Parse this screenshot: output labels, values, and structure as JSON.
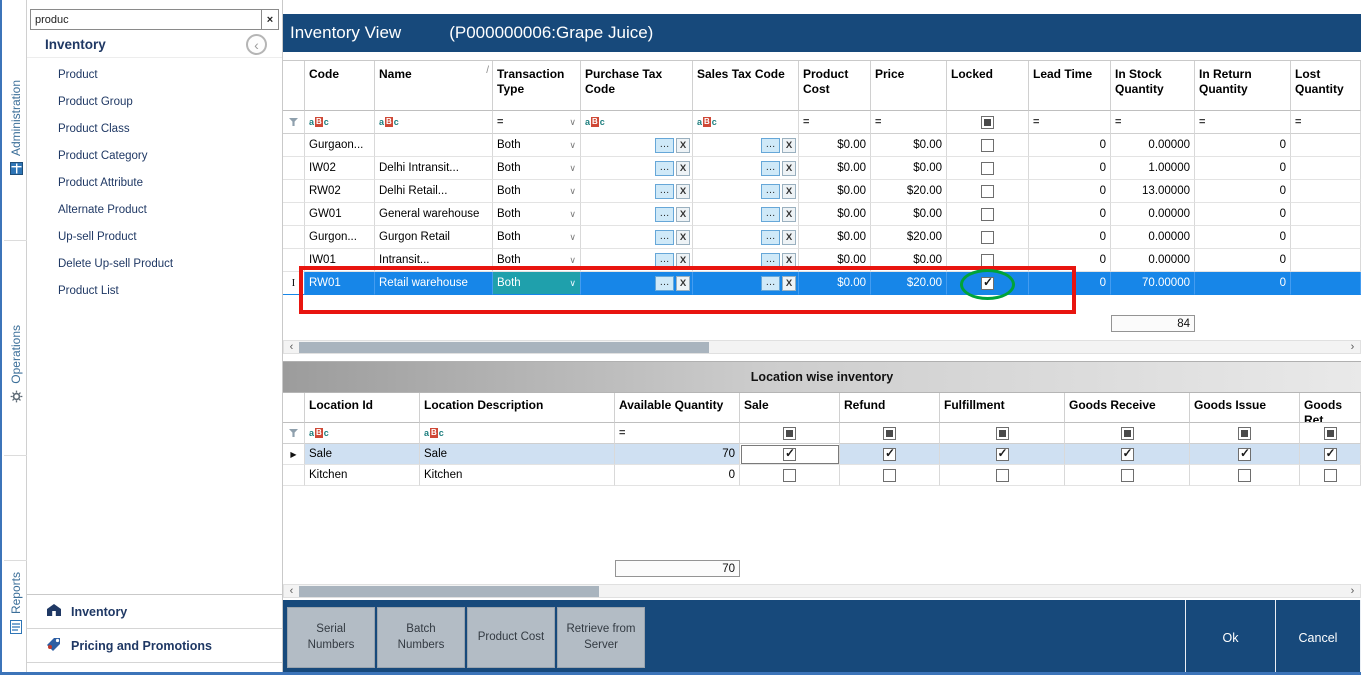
{
  "colors": {
    "title_bar": "#17497B",
    "selected_row": "#1786E8",
    "sidebar_text": "#1F3864",
    "annotation_red": "#E8150F",
    "annotation_green": "#00A33A"
  },
  "icons": {
    "search_clear": "×",
    "back": "‹",
    "dropdown": "∨",
    "ellipsis": "…",
    "clear_x": "X",
    "abc_a": "a",
    "abc_b": "B",
    "abc_c": "c",
    "equals": "=",
    "sort": "/",
    "row_edit": "I",
    "row_current": "▶",
    "scroll_left": "‹",
    "scroll_right": "›"
  },
  "vertical_nav": {
    "items": [
      {
        "label": "Administration"
      },
      {
        "label": "Operations"
      },
      {
        "label": "Reports"
      }
    ]
  },
  "sidebar": {
    "search_value": "produc",
    "title": "Inventory",
    "items": [
      "Product",
      "Product Group",
      "Product Class",
      "Product Category",
      "Product Attribute",
      "Alternate Product",
      "Up-sell Product",
      "Delete Up-sell Product",
      "Product List"
    ],
    "footer_items": [
      {
        "label": "Inventory"
      },
      {
        "label": "Pricing and Promotions"
      }
    ]
  },
  "title_bar": {
    "view_title": "Inventory View",
    "record_title": "(P000000006:Grape Juice)"
  },
  "inventory_grid": {
    "columns": {
      "code": "Code",
      "name": "Name",
      "transaction_type": "Transaction Type",
      "purchase_tax": "Purchase Tax Code",
      "sales_tax": "Sales Tax Code",
      "product_cost": "Product Cost",
      "price": "Price",
      "locked": "Locked",
      "lead_time": "Lead Time",
      "in_stock": "In Stock Quantity",
      "in_return": "In Return Quantity",
      "lost": "Lost Quantity"
    },
    "rows": [
      {
        "code": "Gurgaon...",
        "name": "",
        "transaction_type": "Both",
        "product_cost": "$0.00",
        "price": "$0.00",
        "locked": false,
        "lead_time": "0",
        "in_stock": "0.00000",
        "in_return": "0",
        "lost": "",
        "selected": false
      },
      {
        "code": "IW02",
        "name": "Delhi Intransit...",
        "transaction_type": "Both",
        "product_cost": "$0.00",
        "price": "$0.00",
        "locked": false,
        "lead_time": "0",
        "in_stock": "1.00000",
        "in_return": "0",
        "lost": "",
        "selected": false
      },
      {
        "code": "RW02",
        "name": "Delhi Retail...",
        "transaction_type": "Both",
        "product_cost": "$0.00",
        "price": "$20.00",
        "locked": false,
        "lead_time": "0",
        "in_stock": "13.00000",
        "in_return": "0",
        "lost": "",
        "selected": false
      },
      {
        "code": "GW01",
        "name": "General warehouse",
        "transaction_type": "Both",
        "product_cost": "$0.00",
        "price": "$0.00",
        "locked": false,
        "lead_time": "0",
        "in_stock": "0.00000",
        "in_return": "0",
        "lost": "",
        "selected": false
      },
      {
        "code": "Gurgon...",
        "name": "Gurgon Retail",
        "transaction_type": "Both",
        "product_cost": "$0.00",
        "price": "$20.00",
        "locked": false,
        "lead_time": "0",
        "in_stock": "0.00000",
        "in_return": "0",
        "lost": "",
        "selected": false
      },
      {
        "code": "IW01",
        "name": "Intransit...",
        "transaction_type": "Both",
        "product_cost": "$0.00",
        "price": "$0.00",
        "locked": false,
        "lead_time": "0",
        "in_stock": "0.00000",
        "in_return": "0",
        "lost": "",
        "selected": false
      },
      {
        "code": "RW01",
        "name": "Retail warehouse",
        "transaction_type": "Both",
        "product_cost": "$0.00",
        "price": "$20.00",
        "locked": true,
        "lead_time": "0",
        "in_stock": "70.00000",
        "in_return": "0",
        "lost": "",
        "selected": true
      }
    ],
    "in_stock_total": "84"
  },
  "location_grid": {
    "title": "Location wise inventory",
    "columns": {
      "location_id": "Location Id",
      "description": "Location Description",
      "available": "Available Quantity",
      "sale": "Sale",
      "refund": "Refund",
      "fulfillment": "Fulfillment",
      "goods_receive": "Goods Receive",
      "goods_issue": "Goods Issue",
      "goods_return": "Goods Ret"
    },
    "rows": [
      {
        "location_id": "Sale",
        "description": "Sale",
        "available": "70",
        "sale": true,
        "refund": true,
        "fulfillment": true,
        "goods_receive": true,
        "goods_issue": true,
        "goods_return": true,
        "selected": true
      },
      {
        "location_id": "Kitchen",
        "description": "Kitchen",
        "available": "0",
        "sale": false,
        "refund": false,
        "fulfillment": false,
        "goods_receive": false,
        "goods_issue": false,
        "goods_return": false,
        "selected": false
      }
    ],
    "available_total": "70"
  },
  "footer": {
    "action_buttons": [
      "Serial Numbers",
      "Batch Numbers",
      "Product Cost",
      "Retrieve from Server"
    ],
    "ok": "Ok",
    "cancel": "Cancel"
  }
}
